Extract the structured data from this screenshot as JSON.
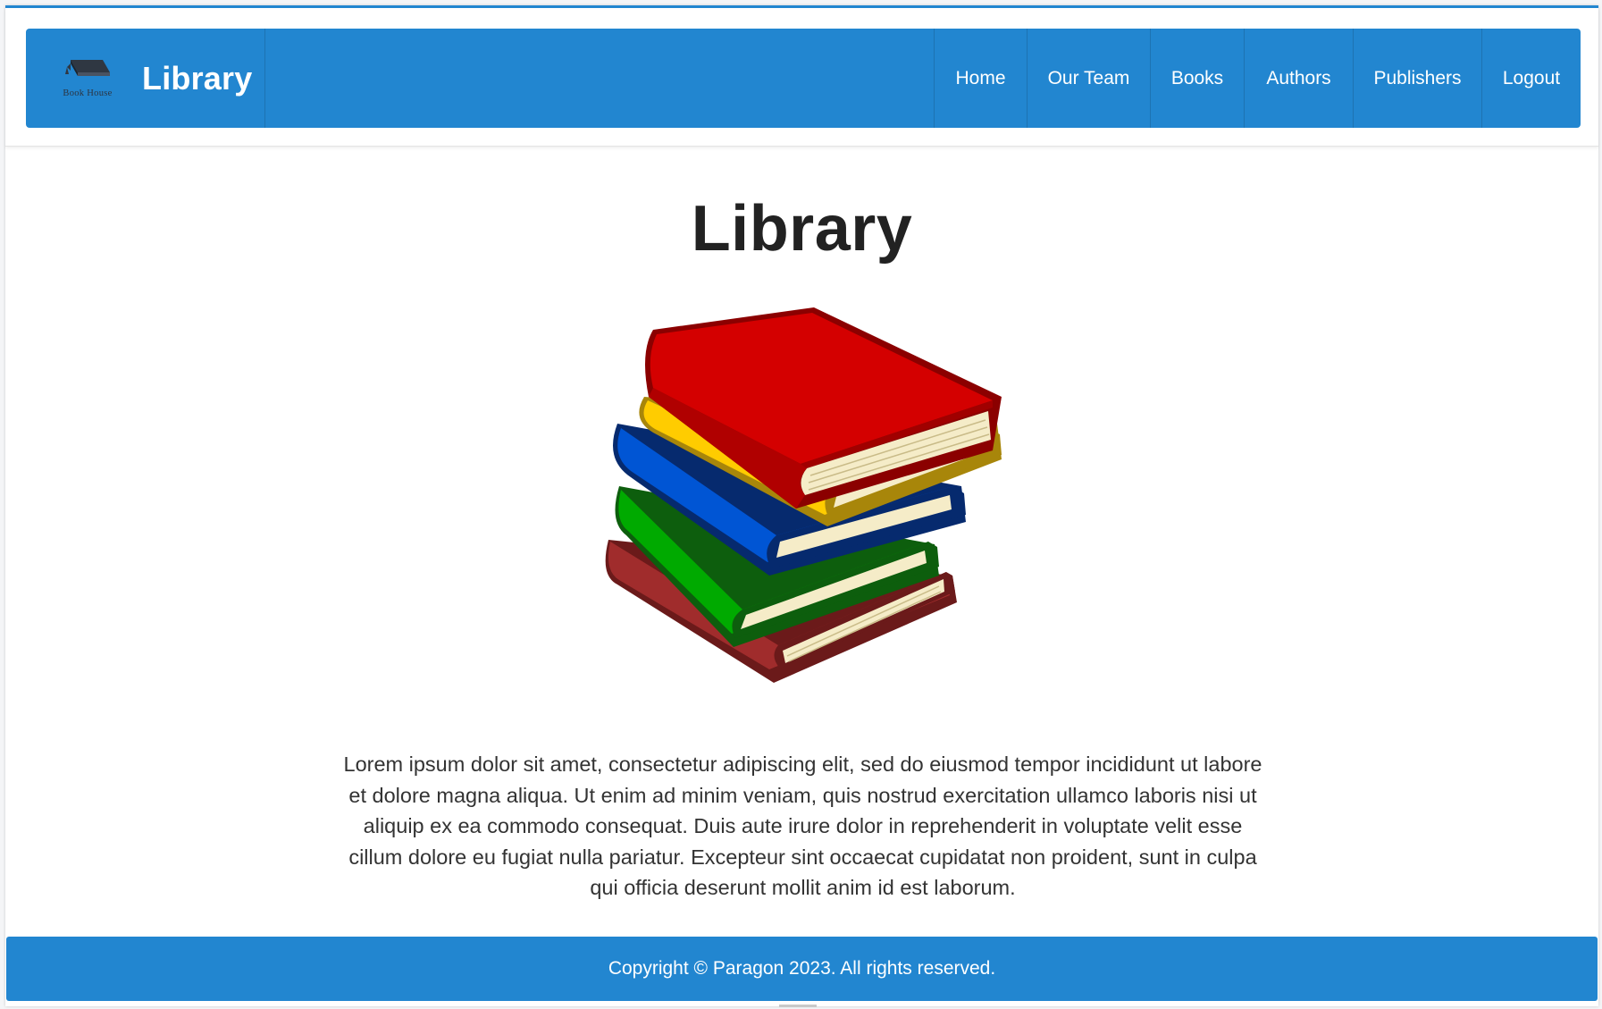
{
  "navbar": {
    "brand_logo_text": "Book House",
    "brand_title": "Library",
    "items": [
      {
        "label": "Home"
      },
      {
        "label": "Our Team"
      },
      {
        "label": "Books"
      },
      {
        "label": "Authors"
      },
      {
        "label": "Publishers"
      },
      {
        "label": "Logout"
      }
    ]
  },
  "main": {
    "title": "Library",
    "image": "book-stack-illustration",
    "description": "Lorem ipsum dolor sit amet, consectetur adipiscing elit, sed do eiusmod tempor incididunt ut labore et dolore magna aliqua. Ut enim ad minim veniam, quis nostrud exercitation ullamco laboris nisi ut aliquip ex ea commodo consequat. Duis aute irure dolor in reprehenderit in voluptate velit esse cillum dolore eu fugiat nulla pariatur. Excepteur sint occaecat cupidatat non proident, sunt in culpa qui officia deserunt mollit anim id est laborum."
  },
  "footer": {
    "copyright": "Copyright © Paragon 2023. All rights reserved."
  },
  "colors": {
    "primary": "#2286d0",
    "text": "#222222",
    "book_red": "#d40000",
    "book_yellow": "#ffcc00",
    "book_blue": "#0055d4",
    "book_green": "#00aa00",
    "book_maroon": "#a02c2c"
  }
}
